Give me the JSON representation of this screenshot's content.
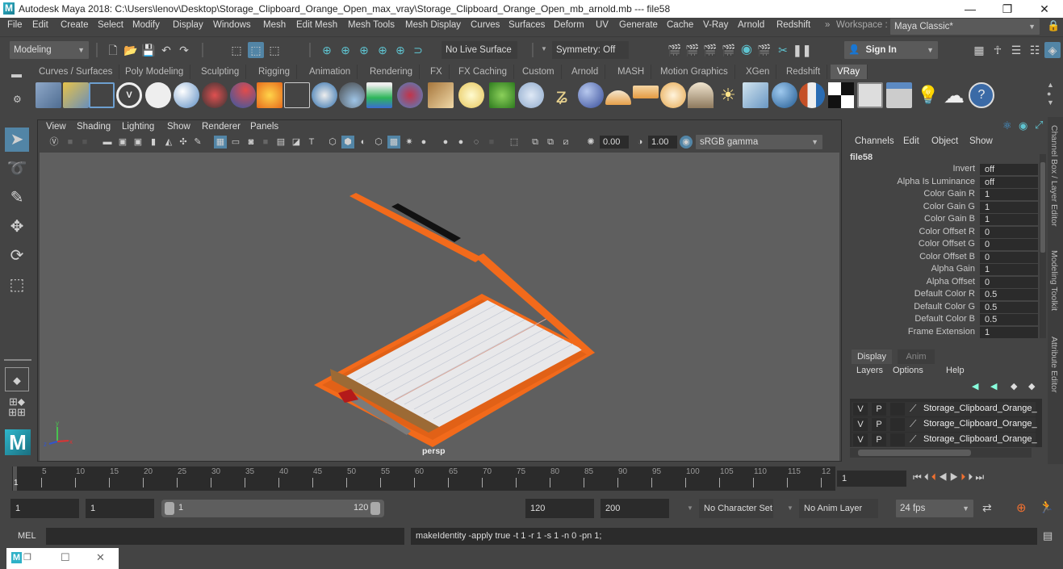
{
  "window": {
    "title": "Autodesk Maya 2018: C:\\Users\\lenov\\Desktop\\Storage_Clipboard_Orange_Open_max_vray\\Storage_Clipboard_Orange_Open_mb_arnold.mb  ---  file58",
    "app_icon": "maya-icon",
    "controls": {
      "minimize": "—",
      "restore": "❐",
      "close": "✕"
    }
  },
  "menubar": {
    "items": [
      "File",
      "Edit",
      "Create",
      "Select",
      "Modify",
      "Display",
      "Windows",
      "Mesh",
      "Edit Mesh",
      "Mesh Tools",
      "Mesh Display",
      "Curves",
      "Surfaces",
      "Deform",
      "UV",
      "Generate",
      "Cache",
      "V-Ray",
      "Arnold",
      "Redshift"
    ],
    "workspace_label": "Workspace :",
    "workspace_value": "Maya Classic*"
  },
  "statusline": {
    "mode": "Modeling",
    "live_surface": "No Live Surface",
    "symmetry": "Symmetry: Off",
    "sign_in": "Sign In"
  },
  "shelf": {
    "tabs": [
      "Curves / Surfaces",
      "Poly Modeling",
      "Sculpting",
      "Rigging",
      "Animation",
      "Rendering",
      "FX",
      "FX Caching",
      "Custom",
      "Arnold",
      "MASH",
      "Motion Graphics",
      "XGen",
      "Redshift",
      "VRay"
    ],
    "active_tab": "VRay"
  },
  "viewport": {
    "menus": [
      "View",
      "Shading",
      "Lighting",
      "Show",
      "Renderer",
      "Panels"
    ],
    "exposure": "0.00",
    "gamma": "1.00",
    "color_space": "sRGB gamma",
    "camera_label": "persp",
    "axis": {
      "x": "x",
      "y": "y",
      "z": "z"
    }
  },
  "channel_box": {
    "menus": [
      "Channels",
      "Edit",
      "Object",
      "Show"
    ],
    "node_name": "file58",
    "attributes": [
      {
        "label": "Invert",
        "value": "off"
      },
      {
        "label": "Alpha Is Luminance",
        "value": "off"
      },
      {
        "label": "Color Gain R",
        "value": "1"
      },
      {
        "label": "Color Gain G",
        "value": "1"
      },
      {
        "label": "Color Gain B",
        "value": "1"
      },
      {
        "label": "Color Offset R",
        "value": "0"
      },
      {
        "label": "Color Offset G",
        "value": "0"
      },
      {
        "label": "Color Offset B",
        "value": "0"
      },
      {
        "label": "Alpha Gain",
        "value": "1"
      },
      {
        "label": "Alpha Offset",
        "value": "0"
      },
      {
        "label": "Default Color R",
        "value": "0.5"
      },
      {
        "label": "Default Color G",
        "value": "0.5"
      },
      {
        "label": "Default Color B",
        "value": "0.5"
      },
      {
        "label": "Frame Extension",
        "value": "1"
      }
    ]
  },
  "side_tabs": [
    "Channel Box / Layer Editor",
    "Modeling Toolkit",
    "Attribute Editor"
  ],
  "layer_editor": {
    "tabs": [
      "Display",
      "Anim"
    ],
    "active_tab": "Display",
    "menus": [
      "Layers",
      "Options",
      "Help"
    ],
    "layers": [
      {
        "v": "V",
        "p": "P",
        "name": "Storage_Clipboard_Orange_"
      },
      {
        "v": "V",
        "p": "P",
        "name": "Storage_Clipboard_Orange_"
      },
      {
        "v": "V",
        "p": "P",
        "name": "Storage_Clipboard_Orange_"
      }
    ]
  },
  "timeline": {
    "ticks": [
      "5",
      "10",
      "15",
      "20",
      "25",
      "30",
      "35",
      "40",
      "45",
      "50",
      "55",
      "60",
      "65",
      "70",
      "75",
      "80",
      "85",
      "90",
      "95",
      "100",
      "105",
      "110",
      "115",
      "12"
    ],
    "current_frame_marker": "1",
    "current_frame": "1"
  },
  "range": {
    "start": "1",
    "playback_start": "1",
    "slider_min": "1",
    "slider_max": "120",
    "playback_end": "120",
    "end": "200",
    "character_set": "No Character Set",
    "anim_layer": "No Anim Layer",
    "fps": "24 fps"
  },
  "command_line": {
    "language": "MEL",
    "input": "",
    "result": "makeIdentity -apply true -t 1 -r 1 -s 1 -n 0 -pn 1;"
  },
  "colors": {
    "accent": "#5285a6",
    "teal": "#5fc4d1",
    "clipboard_orange": "#f26a1b"
  }
}
